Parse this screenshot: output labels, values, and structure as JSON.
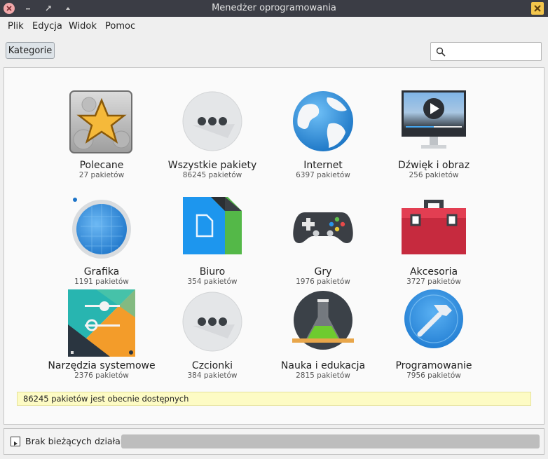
{
  "window": {
    "title": "Menedżer oprogramowania"
  },
  "menu": [
    "Plik",
    "Edycja",
    "Widok",
    "Pomoc"
  ],
  "toolbar": {
    "categories_button": "Kategorie",
    "search_value": ""
  },
  "categories": [
    {
      "name": "Polecane",
      "count": "27 pakietów",
      "icon": "featured-star-icon"
    },
    {
      "name": "Wszystkie pakiety",
      "count": "86245 pakietów",
      "icon": "all-packages-icon"
    },
    {
      "name": "Internet",
      "count": "6397 pakietów",
      "icon": "globe-icon"
    },
    {
      "name": "Dźwięk i obraz",
      "count": "256 pakietów",
      "icon": "multimedia-icon"
    },
    {
      "name": "Grafika",
      "count": "1191 pakietów",
      "icon": "graphics-icon"
    },
    {
      "name": "Biuro",
      "count": "354 pakietów",
      "icon": "office-icon"
    },
    {
      "name": "Gry",
      "count": "1976 pakietów",
      "icon": "gamepad-icon"
    },
    {
      "name": "Akcesoria",
      "count": "3727 pakietów",
      "icon": "toolbox-icon"
    },
    {
      "name": "Narzędzia systemowe",
      "count": "2376 pakietów",
      "icon": "system-tools-icon"
    },
    {
      "name": "Czcionki",
      "count": "384 pakietów",
      "icon": "fonts-icon"
    },
    {
      "name": "Nauka i edukacja",
      "count": "2815 pakietów",
      "icon": "science-flask-icon"
    },
    {
      "name": "Programowanie",
      "count": "7956 pakietów",
      "icon": "development-icon"
    }
  ],
  "info_text": "86245 pakietów jest obecnie dostępnych",
  "status": {
    "text": "Brak bieżących działań",
    "progress": 0
  }
}
